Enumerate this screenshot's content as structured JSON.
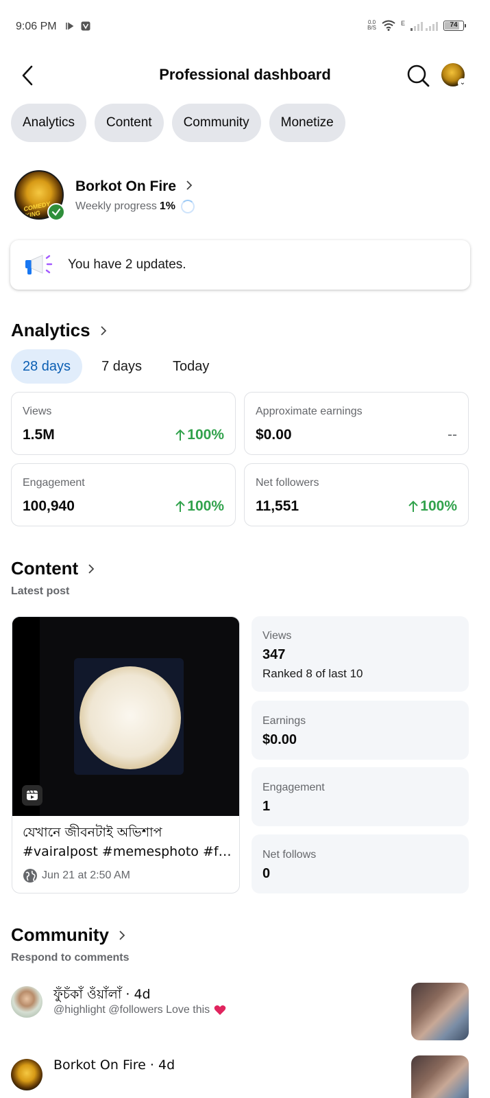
{
  "status_bar": {
    "time": "9:06 PM",
    "net_speed_top": "0.0",
    "net_speed_bottom": "B/S",
    "network_type": "E",
    "battery": "74"
  },
  "header": {
    "title": "Professional dashboard"
  },
  "pills": [
    {
      "label": "Analytics"
    },
    {
      "label": "Content"
    },
    {
      "label": "Community"
    },
    {
      "label": "Monetize"
    }
  ],
  "profile": {
    "name": "Borkot On Fire",
    "weekly_progress_label": "Weekly progress",
    "weekly_progress_value": "1%",
    "avatar_text": "COMEDY KING"
  },
  "updates": {
    "text": "You have 2 updates."
  },
  "analytics": {
    "title": "Analytics",
    "tabs": [
      {
        "label": "28 days",
        "active": true
      },
      {
        "label": "7 days",
        "active": false
      },
      {
        "label": "Today",
        "active": false
      }
    ],
    "metrics": [
      {
        "label": "Views",
        "value": "1.5M",
        "change": "100%"
      },
      {
        "label": "Approximate earnings",
        "value": "$0.00",
        "change": "--"
      },
      {
        "label": "Engagement",
        "value": "100,940",
        "change": "100%"
      },
      {
        "label": "Net followers",
        "value": "11,551",
        "change": "100%"
      }
    ]
  },
  "content": {
    "title": "Content",
    "subtitle": "Latest post",
    "post": {
      "caption_line1": "যেখানে জীবনটাই অভিশাপ",
      "caption_line2": "#vairalpost #memesphoto #fa...",
      "date": "Jun 21 at 2:50 AM"
    },
    "stats": [
      {
        "label": "Views",
        "value": "347",
        "extra": "Ranked 8 of last 10"
      },
      {
        "label": "Earnings",
        "value": "$0.00"
      },
      {
        "label": "Engagement",
        "value": "1"
      },
      {
        "label": "Net follows",
        "value": "0"
      }
    ]
  },
  "community": {
    "title": "Community",
    "subtitle": "Respond to comments",
    "comments": [
      {
        "name": "ফুঁচঁকাঁ ওঁয়াঁলাঁ · 4d",
        "text": "@highlight @followers Love this"
      },
      {
        "name": "Borkot On Fire · 4d",
        "text": ""
      }
    ]
  },
  "colors": {
    "accent_blue": "#0a5eb3",
    "positive_green": "#31a24c",
    "pill_bg": "#e4e6eb",
    "verified_green": "#2f8f3a"
  }
}
